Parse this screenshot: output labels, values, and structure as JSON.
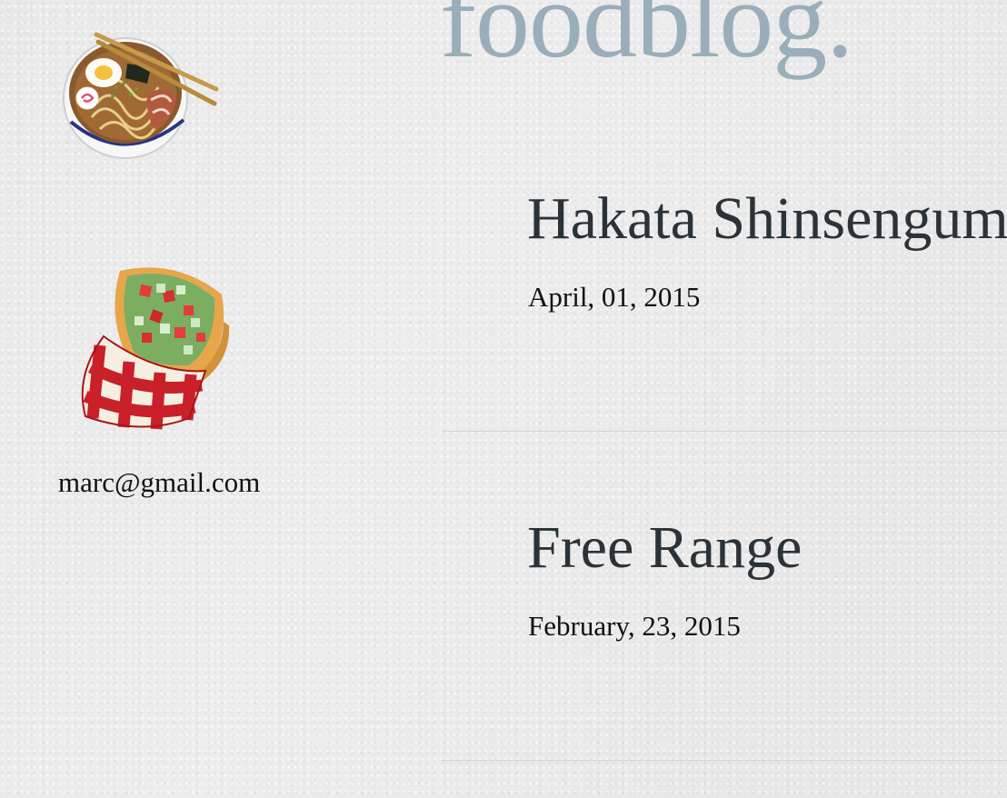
{
  "header": {
    "site_title": "foodblog."
  },
  "sidebar": {
    "icons": [
      "ramen-bowl-icon",
      "burrito-icon"
    ],
    "email": "marc@gmail.com"
  },
  "posts": [
    {
      "title": "Hakata Shinsengumi",
      "date": "April, 01, 2015"
    },
    {
      "title": "Free Range",
      "date": "February, 23, 2015"
    }
  ],
  "colors": {
    "title": "#9aaeba",
    "post_title": "#2b3338",
    "background": "#ededed"
  }
}
